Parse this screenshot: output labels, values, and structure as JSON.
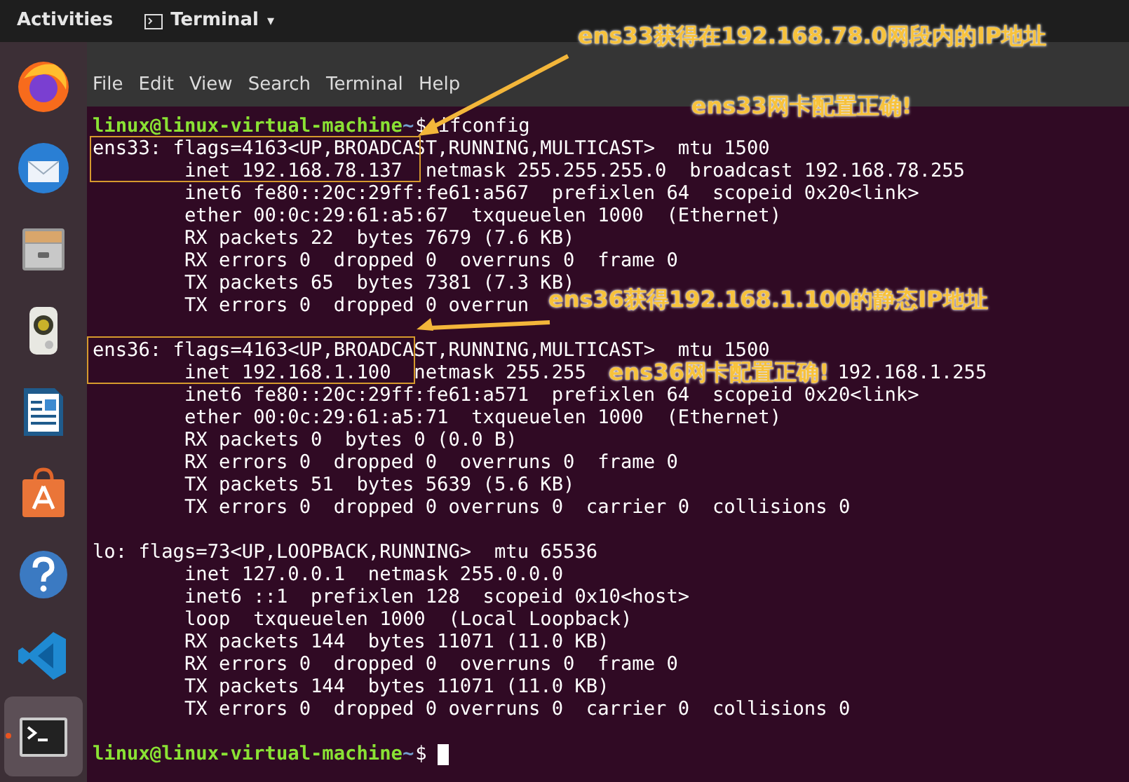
{
  "top_bar": {
    "activities": "Activities",
    "app_menu": "Terminal",
    "app_menu_caret": "▾"
  },
  "dock": [
    {
      "kind": "firefox",
      "selected": false
    },
    {
      "kind": "mail",
      "selected": false
    },
    {
      "kind": "files",
      "selected": false
    },
    {
      "kind": "speaker",
      "selected": false
    },
    {
      "kind": "writer",
      "selected": false
    },
    {
      "kind": "store",
      "selected": false
    },
    {
      "kind": "help",
      "selected": false
    },
    {
      "kind": "code",
      "selected": false
    },
    {
      "kind": "terminal",
      "selected": true
    }
  ],
  "terminal": {
    "menu": [
      "File",
      "Edit",
      "View",
      "Search",
      "Terminal",
      "Help"
    ],
    "lines": [
      {
        "kind": "prompt",
        "user": "linux@linux-virtual-machine",
        "path": "~",
        "symbol": "$",
        "command": "ifconfig",
        "note": "ens33网卡配置正确!"
      },
      {
        "kind": "output",
        "segments": [
          "ens33: flags=4163<UP,BROADCAST,RUNNING,MULTICAST>  mtu 1500"
        ]
      },
      {
        "kind": "output",
        "segments": [
          "        inet 192.168.78.137  netmask 255.255.255.0  broadcast 192.168.78.255"
        ]
      },
      {
        "kind": "output",
        "segments": [
          "        inet6 fe80::20c:29ff:fe61:a567  prefixlen 64  scopeid 0x20<link>"
        ]
      },
      {
        "kind": "output",
        "segments": [
          "        ether 00:0c:29:61:a5:67  txqueuelen 1000  (Ethernet)"
        ]
      },
      {
        "kind": "output",
        "segments": [
          "        RX packets 22  bytes 7679 (7.6 KB)"
        ]
      },
      {
        "kind": "output",
        "segments": [
          "        RX errors 0  dropped 0  overruns 0  frame 0"
        ]
      },
      {
        "kind": "output",
        "segments": [
          "        TX packets 65  bytes 7381 (7.3 KB)"
        ]
      },
      {
        "kind": "output",
        "segments": [
          "        TX errors 0  dropped 0 overrun"
        ],
        "note": "ens36获得192.168.1.100的静态IP地址"
      },
      {
        "kind": "blank"
      },
      {
        "kind": "output",
        "segments": [
          "ens36: flags=4163<UP,BROADCAST,RUNNING,MULTICAST>  mtu 1500"
        ]
      },
      {
        "kind": "output",
        "segments": [
          "        inet 192.168.1.100  netmask 255.255",
          "192.168.1.255"
        ],
        "note": "ens36网卡配置正确!"
      },
      {
        "kind": "output",
        "segments": [
          "        inet6 fe80::20c:29ff:fe61:a571  prefixlen 64  scopeid 0x20<link>"
        ]
      },
      {
        "kind": "output",
        "segments": [
          "        ether 00:0c:29:61:a5:71  txqueuelen 1000  (Ethernet)"
        ]
      },
      {
        "kind": "output",
        "segments": [
          "        RX packets 0  bytes 0 (0.0 B)"
        ]
      },
      {
        "kind": "output",
        "segments": [
          "        RX errors 0  dropped 0  overruns 0  frame 0"
        ]
      },
      {
        "kind": "output",
        "segments": [
          "        TX packets 51  bytes 5639 (5.6 KB)"
        ]
      },
      {
        "kind": "output",
        "segments": [
          "        TX errors 0  dropped 0 overruns 0  carrier 0  collisions 0"
        ]
      },
      {
        "kind": "blank"
      },
      {
        "kind": "output",
        "segments": [
          "lo: flags=73<UP,LOOPBACK,RUNNING>  mtu 65536"
        ]
      },
      {
        "kind": "output",
        "segments": [
          "        inet 127.0.0.1  netmask 255.0.0.0"
        ]
      },
      {
        "kind": "output",
        "segments": [
          "        inet6 ::1  prefixlen 128  scopeid 0x10<host>"
        ]
      },
      {
        "kind": "output",
        "segments": [
          "        loop  txqueuelen 1000  (Local Loopback)"
        ]
      },
      {
        "kind": "output",
        "segments": [
          "        RX packets 144  bytes 11071 (11.0 KB)"
        ]
      },
      {
        "kind": "output",
        "segments": [
          "        RX errors 0  dropped 0  overruns 0  frame 0"
        ]
      },
      {
        "kind": "output",
        "segments": [
          "        TX packets 144  bytes 11071 (11.0 KB)"
        ]
      },
      {
        "kind": "output",
        "segments": [
          "        TX errors 0  dropped 0 overruns 0  carrier 0  collisions 0"
        ]
      },
      {
        "kind": "blank"
      },
      {
        "kind": "prompt",
        "user": "linux@linux-virtual-machine",
        "path": "~",
        "symbol": "$",
        "cursor": true
      }
    ]
  },
  "top_note": "ens33获得在192.168.78.0网段内的IP地址"
}
